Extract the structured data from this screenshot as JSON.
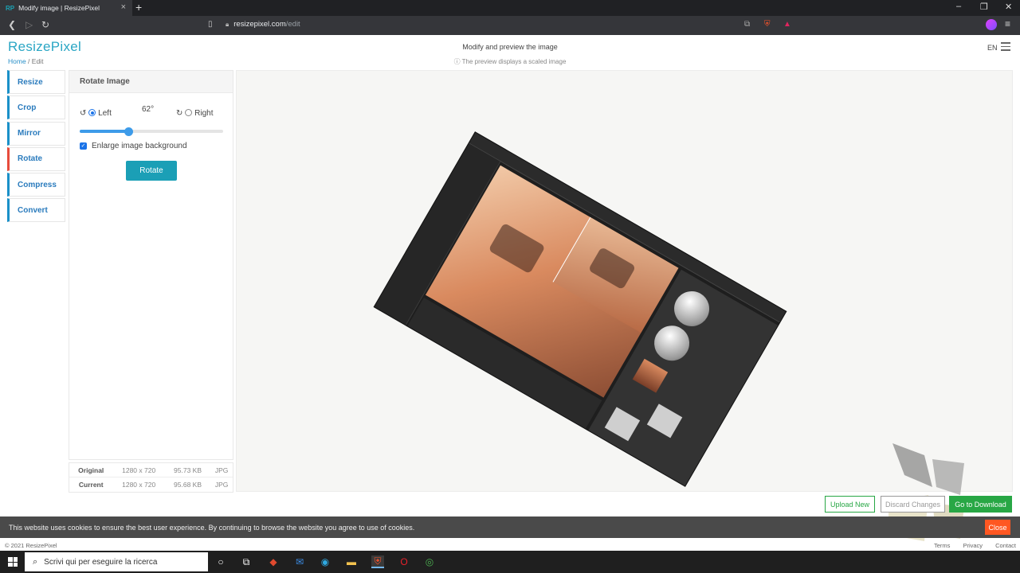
{
  "browser": {
    "tab_title": "Modify image | ResizePixel",
    "tab_favicon": "RP",
    "url_host": "resizepixel.com",
    "url_path": "/edit"
  },
  "site": {
    "logo": "ResizePixel",
    "breadcrumb_home": "Home",
    "breadcrumb_sep": " / ",
    "breadcrumb_current": "Edit",
    "header_title": "Modify and preview the image",
    "header_sub": "The preview displays a scaled image",
    "language": "EN"
  },
  "sidenav": {
    "items": [
      {
        "label": "Resize"
      },
      {
        "label": "Crop"
      },
      {
        "label": "Mirror"
      },
      {
        "label": "Rotate"
      },
      {
        "label": "Compress"
      },
      {
        "label": "Convert"
      }
    ],
    "active": "Rotate"
  },
  "rotate_panel": {
    "title": "Rotate Image",
    "left_label": "Left",
    "right_label": "Right",
    "selected_direction": "Left",
    "degrees_display": "62°",
    "slider_fraction": 0.34,
    "enlarge_label": "Enlarge image background",
    "enlarge_checked": true,
    "rotate_button": "Rotate"
  },
  "file_info": {
    "rows": [
      {
        "label": "Original",
        "dimensions": "1280 x 720",
        "size": "95.73 KB",
        "format": "JPG"
      },
      {
        "label": "Current",
        "dimensions": "1280 x 720",
        "size": "95.68 KB",
        "format": "JPG"
      }
    ]
  },
  "actions": {
    "upload_new": "Upload New",
    "discard_changes": "Discard Changes",
    "go_to_download": "Go to Download"
  },
  "cookie": {
    "message": "This website uses cookies to ensure the best user experience. By continuing to browse the website you agree to use of cookies.",
    "close": "Close"
  },
  "footer": {
    "copyright": "© 2021 ResizePixel",
    "links": [
      "Terms",
      "Privacy",
      "Contact"
    ]
  },
  "taskbar": {
    "search_placeholder": "Scrivi qui per eseguire la ricerca"
  },
  "colors": {
    "brand": "#2aa6c4",
    "primary_button": "#1b9fb6",
    "success": "#28a745",
    "active_marker": "#e74c3c",
    "cookie_close": "#ff5722"
  }
}
